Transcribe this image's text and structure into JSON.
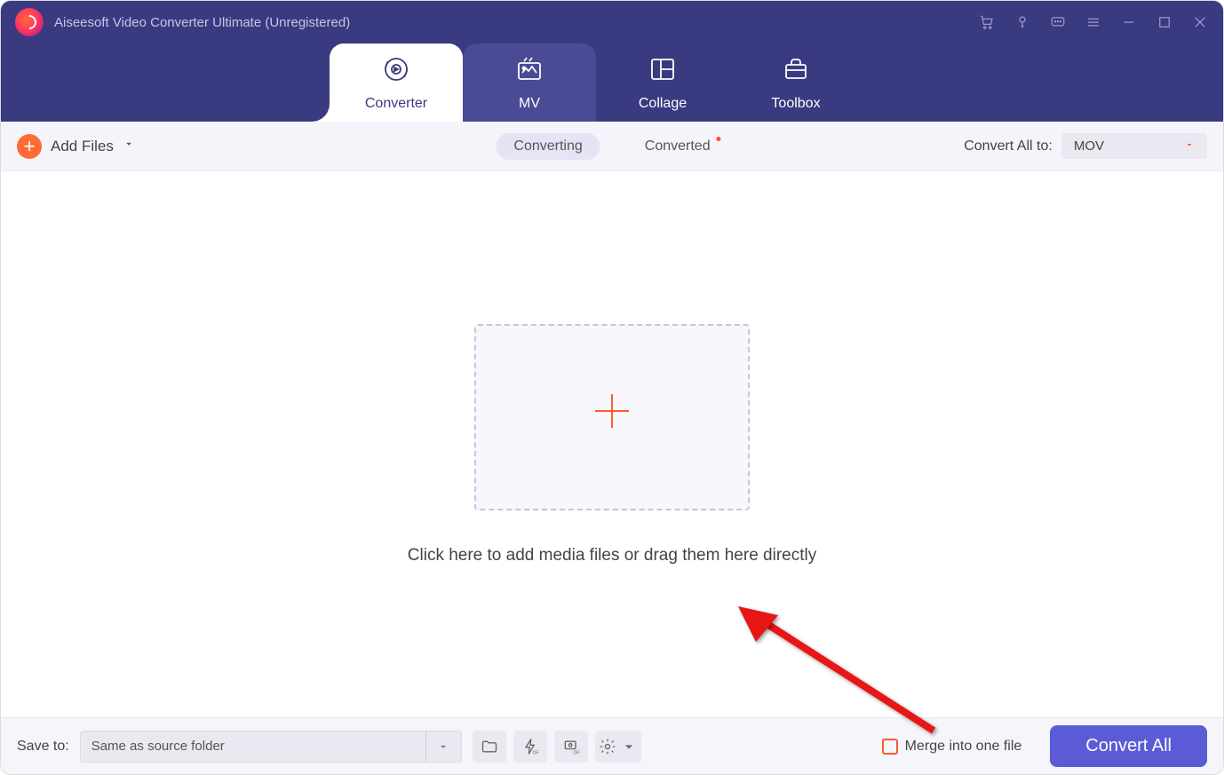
{
  "app_title": "Aiseesoft Video Converter Ultimate (Unregistered)",
  "nav_tabs": {
    "converter": "Converter",
    "mv": "MV",
    "collage": "Collage",
    "toolbox": "Toolbox"
  },
  "toolbar": {
    "add_files_label": "Add Files",
    "status_converting": "Converting",
    "status_converted": "Converted",
    "convert_all_to_label": "Convert All to:",
    "format_value": "MOV"
  },
  "main": {
    "drop_hint": "Click here to add media files or drag them here directly"
  },
  "footer": {
    "save_to_label": "Save to:",
    "save_path": "Same as source folder",
    "merge_label": "Merge into one file",
    "convert_all_button": "Convert All"
  }
}
